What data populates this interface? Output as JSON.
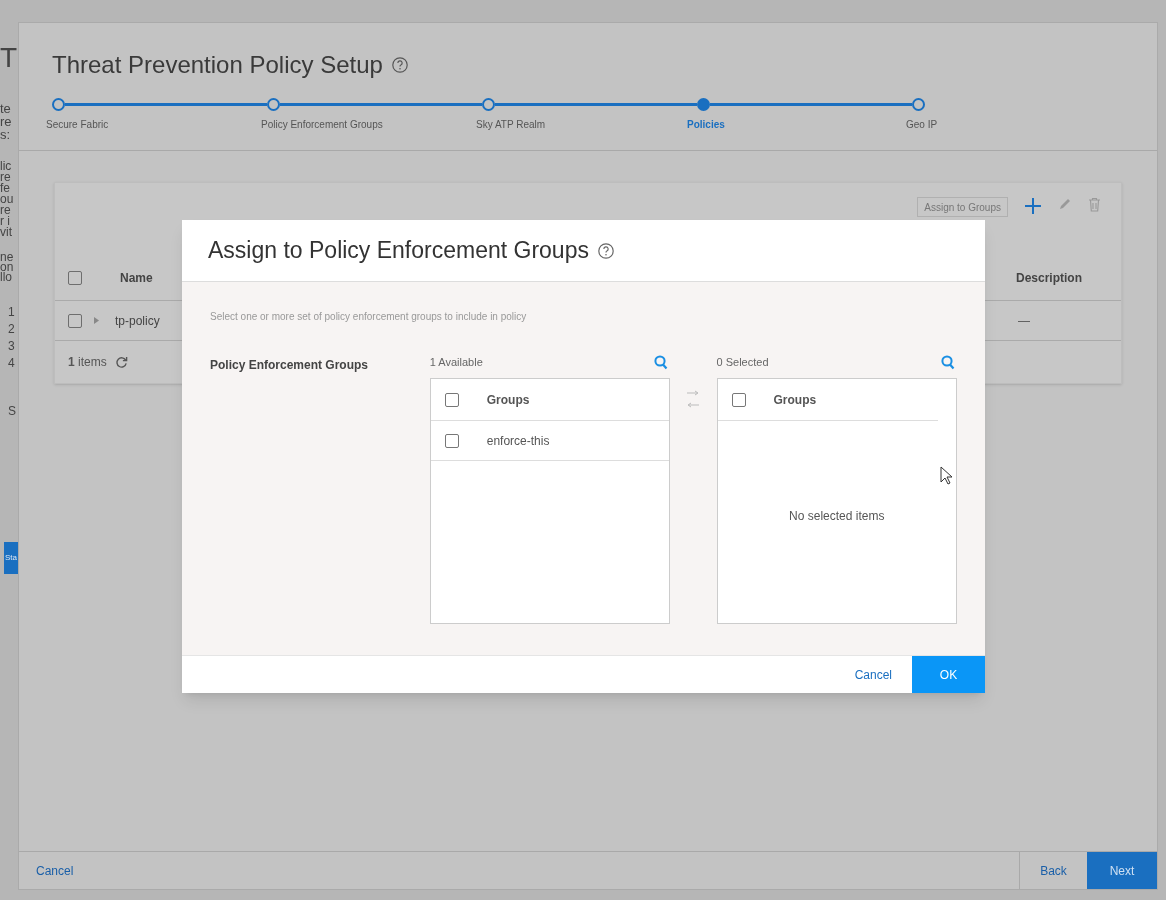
{
  "background_page": {
    "heading_fragment": "T",
    "text_fragments": [
      "te",
      "re",
      "s:"
    ],
    "paragraph_fragments": [
      "lic",
      "re",
      "fe",
      "ou",
      "re",
      "r i",
      "vit"
    ],
    "paragraph_fragments_2": [
      "ne",
      "on",
      "llo"
    ],
    "list_fragments": [
      "1",
      "2",
      "3",
      "4"
    ],
    "trailing_fragment": "S",
    "button_fragment": "Sta"
  },
  "wizard": {
    "title": "Threat Prevention Policy Setup",
    "steps": [
      {
        "label": "Secure Fabric",
        "selected": false
      },
      {
        "label": "Policy Enforcement Groups",
        "selected": false
      },
      {
        "label": "Sky ATP Realm",
        "selected": false
      },
      {
        "label": "Policies",
        "selected": true
      },
      {
        "label": "Geo IP",
        "selected": false
      }
    ],
    "table": {
      "assign_button": "Assign to Groups",
      "columns": [
        "Name",
        "Description"
      ],
      "rows": [
        {
          "name": "tp-policy",
          "description": "—",
          "checked": false
        }
      ],
      "header_checked": false,
      "footer": "**1** items"
    },
    "buttons": {
      "cancel": "Cancel",
      "back": "Back",
      "next": "Next"
    }
  },
  "dialog": {
    "title": "Assign to Policy Enforcement Groups",
    "description": "Select one or more set of policy enforcement groups to include in policy",
    "field_label": "Policy Enforcement Groups",
    "available": {
      "caption": "1 Available",
      "column": "Groups",
      "header_checked": false,
      "items": [
        {
          "label": "enforce-this",
          "checked": false
        }
      ]
    },
    "selected": {
      "caption": "0 Selected",
      "column": "Groups",
      "header_checked": false,
      "empty_text": "No selected items"
    },
    "buttons": {
      "cancel": "Cancel",
      "ok": "OK"
    }
  }
}
